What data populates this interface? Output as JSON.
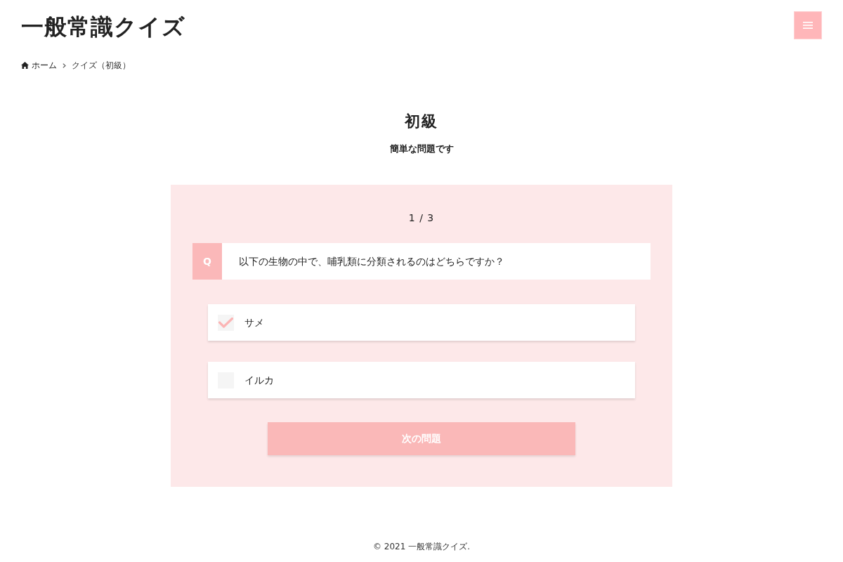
{
  "header": {
    "site_title": "一般常識クイズ"
  },
  "breadcrumb": [
    {
      "kind": "home",
      "label": "ホーム"
    },
    {
      "kind": "current",
      "label": "クイズ（初級）"
    }
  ],
  "page": {
    "title": "初級",
    "subtitle": "簡単な問題です"
  },
  "quiz": {
    "progress": "1 / 3",
    "question_marker": "Q",
    "question": "以下の生物の中で、哺乳類に分類されるのはどちらですか？",
    "options": [
      {
        "label": "サメ",
        "checked": true
      },
      {
        "label": "イルカ",
        "checked": false
      }
    ],
    "next_button": "次の問題"
  },
  "footer": {
    "copyright": "© 2021 一般常識クイズ."
  }
}
